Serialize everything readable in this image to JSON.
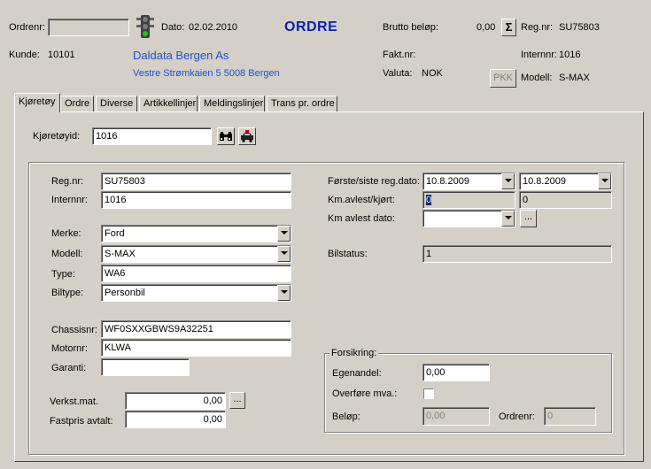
{
  "header": {
    "ordrenr_label": "Ordrenr:",
    "ordrenr_value": "",
    "dato_label": "Dato:",
    "dato_value": "02.02.2010",
    "title": "ORDRE",
    "brutto_label": "Brutto beløp:",
    "brutto_value": "0,00",
    "sum_symbol": "Σ",
    "regnr_label": "Reg.nr:",
    "regnr_value": "SU75803",
    "kunde_label": "Kunde:",
    "kunde_value": "10101",
    "customer_name": "Daldata Bergen As",
    "customer_address": "Vestre Strømkaien 5 5008 Bergen",
    "faktnr_label": "Fakt.nr:",
    "internnr_label": "Internnr:",
    "internnr_value": "1016",
    "valuta_label": "Valuta:",
    "valuta_value": "NOK",
    "pkk_label": "PKK",
    "modell_label": "Modell:",
    "modell_value": "S-MAX"
  },
  "tabs": [
    "Kjøretøy",
    "Ordre",
    "Diverse",
    "Artikkellinjer",
    "Meldingslinjer",
    "Trans pr. ordre"
  ],
  "vehicle": {
    "kjoretoyid_label": "Kjøretøyid:",
    "kjoretoyid_value": "1016",
    "regnr_label": "Reg.nr:",
    "regnr_value": "SU75803",
    "internnr_label": "Internnr:",
    "internnr_value": "1016",
    "merke_label": "Merke:",
    "merke_value": "Ford",
    "modell_label": "Modell:",
    "modell_value": "S-MAX",
    "type_label": "Type:",
    "type_value": "WA6",
    "biltype_label": "Biltype:",
    "biltype_value": "Personbil",
    "chassisnr_label": "Chassisnr:",
    "chassisnr_value": "WF0SXXGBWS9A32251",
    "motornr_label": "Motornr:",
    "motornr_value": "KLWA",
    "garanti_label": "Garanti:",
    "garanti_value": "",
    "verkst_label": "Verkst.mat.",
    "verkst_value": "0,00",
    "fastpris_label": "Fastpris avtalt:",
    "fastpris_value": "0,00",
    "ellipsis": "...",
    "regdato_label": "Første/siste reg.dato:",
    "regdato_first": "10.8.2009",
    "regdato_last": "10.8.2009",
    "km_label": "Km.avlest/kjørt:",
    "km_avlest": "0",
    "km_kjort": "0",
    "km_dato_label": "Km avlest dato:",
    "km_dato_value": "",
    "bilstatus_label": "Bilstatus:",
    "bilstatus_value": "1"
  },
  "insurance": {
    "legend": "Forsikring:",
    "egenandel_label": "Egenandel:",
    "egenandel_value": "0,00",
    "overfore_label": "Overføre mva.:",
    "belop_label": "Beløp:",
    "belop_value": "0,00",
    "ordrenr_label": "Ordrenr:",
    "ordrenr_value": "0"
  }
}
